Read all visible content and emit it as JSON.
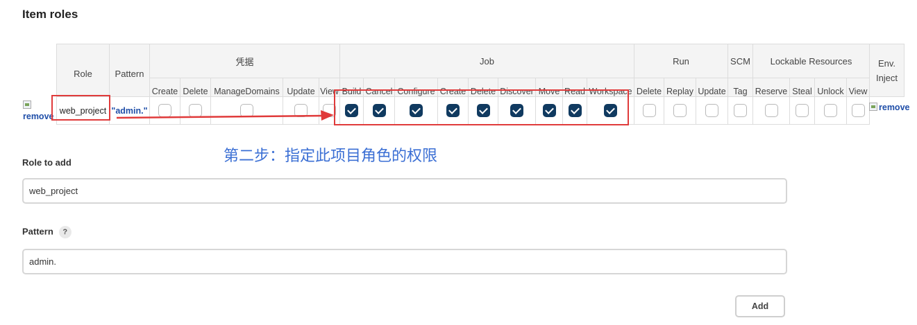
{
  "section_title": "Item roles",
  "table": {
    "role_header": "Role",
    "pattern_header": "Pattern",
    "groups": [
      {
        "label": "凭据",
        "permissions": [
          "Create",
          "Delete",
          "ManageDomains",
          "Update",
          "View"
        ]
      },
      {
        "label": "Job",
        "permissions": [
          "Build",
          "Cancel",
          "Configure",
          "Create",
          "Delete",
          "Discover",
          "Move",
          "Read",
          "Workspace"
        ]
      },
      {
        "label": "Run",
        "permissions": [
          "Delete",
          "Replay",
          "Update"
        ]
      },
      {
        "label": "SCM",
        "permissions": [
          "Tag"
        ]
      },
      {
        "label": "Lockable Resources",
        "permissions": [
          "Reserve",
          "Steal",
          "Unlock",
          "View"
        ]
      },
      {
        "label": "Env. Inject",
        "permissions": []
      }
    ],
    "row": {
      "remove_label": "remove",
      "role": "web_project",
      "pattern": "\"admin.\"",
      "checked": [
        false,
        false,
        false,
        false,
        false,
        true,
        true,
        true,
        true,
        true,
        true,
        true,
        true,
        true,
        false,
        false,
        false,
        false,
        false,
        false,
        false,
        false
      ],
      "remove_right_label": "remove"
    }
  },
  "annotation": "第二步：指定此项目角色的权限",
  "form": {
    "role_to_add_label": "Role to add",
    "role_to_add_value": "web_project",
    "pattern_label": "Pattern",
    "pattern_help": "?",
    "pattern_value": "admin.",
    "add_button": "Add"
  },
  "colors": {
    "checked": "#103a60",
    "annotation": "#3b6fd4",
    "highlight": "#e03a3a",
    "link": "#1f4ea8"
  }
}
